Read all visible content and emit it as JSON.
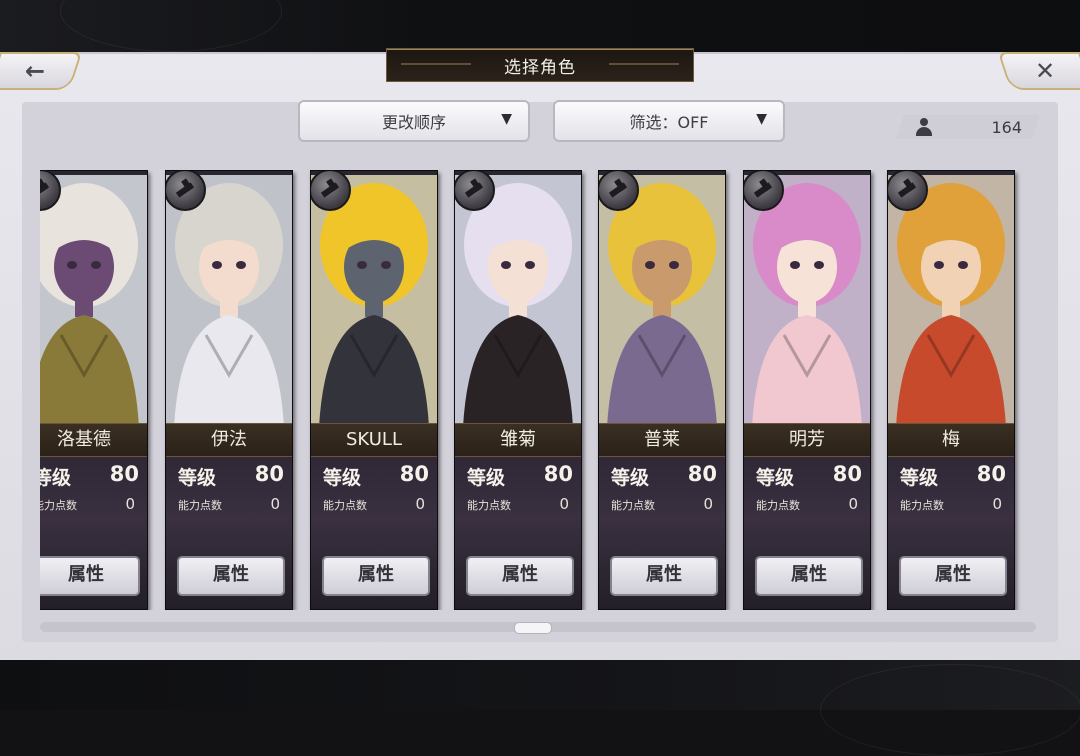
{
  "screen": {
    "title": "选择角色",
    "back_icon": "←",
    "close_icon": "✕"
  },
  "toolbar": {
    "order_label": "更改顺序",
    "filter_label": "筛选：OFF",
    "dropdown_arrow": "▼"
  },
  "counter": {
    "value": "164",
    "icon": "person-icon"
  },
  "cards": [
    {
      "name": "洛基德",
      "level_label": "等级",
      "level": "80",
      "points_label": "能力点数",
      "points": "0",
      "button": "属性",
      "weapon": "weapon-icon",
      "hair": "#e8e3dc",
      "skin": "#6b4a73",
      "outfit": "#8a7a3a"
    },
    {
      "name": "伊法",
      "level_label": "等级",
      "level": "80",
      "points_label": "能力点数",
      "points": "0",
      "button": "属性",
      "weapon": "weapon-icon",
      "hair": "#d8d5cf",
      "skin": "#f3dccd",
      "outfit": "#e8e8ee"
    },
    {
      "name": "SKULL",
      "level_label": "等级",
      "level": "80",
      "points_label": "能力点数",
      "points": "0",
      "button": "属性",
      "weapon": "weapon-icon",
      "hair": "#f0c52a",
      "skin": "#5d6470",
      "outfit": "#33333c"
    },
    {
      "name": "雏菊",
      "level_label": "等级",
      "level": "80",
      "points_label": "能力点数",
      "points": "0",
      "button": "属性",
      "weapon": "weapon-icon",
      "hair": "#e6dff0",
      "skin": "#f5e0d6",
      "outfit": "#2a2326"
    },
    {
      "name": "普莱",
      "level_label": "等级",
      "level": "80",
      "points_label": "能力点数",
      "points": "0",
      "button": "属性",
      "weapon": "weapon-icon",
      "hair": "#e8c23a",
      "skin": "#c99a6c",
      "outfit": "#7b6a90"
    },
    {
      "name": "明芳",
      "level_label": "等级",
      "level": "80",
      "points_label": "能力点数",
      "points": "0",
      "button": "属性",
      "weapon": "weapon-icon",
      "hair": "#d98ac8",
      "skin": "#f7e2d8",
      "outfit": "#f2c8d0"
    },
    {
      "name": "梅",
      "level_label": "等级",
      "level": "80",
      "points_label": "能力点数",
      "points": "0",
      "button": "属性",
      "weapon": "weapon-icon",
      "hair": "#e0a03a",
      "skin": "#f2d2b4",
      "outfit": "#c84a2c"
    }
  ]
}
